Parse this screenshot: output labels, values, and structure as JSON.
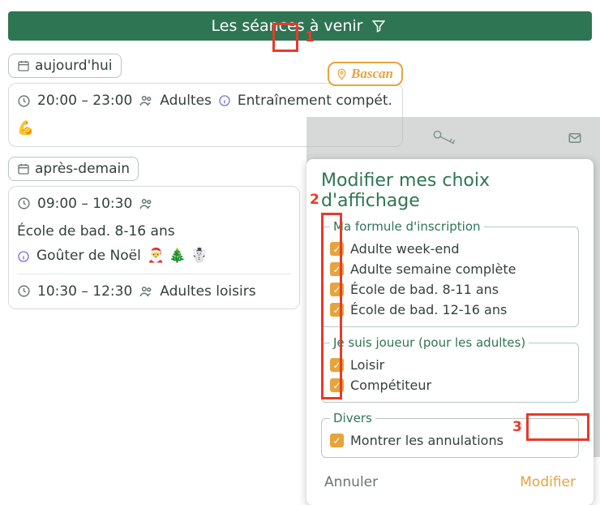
{
  "banner": {
    "title": "Les séances à venir"
  },
  "annotations": {
    "n1": "1",
    "n2": "2",
    "n3": "3"
  },
  "location": {
    "name": "Bascan"
  },
  "days": [
    {
      "label": "aujourd'hui",
      "sessions": [
        {
          "time": "20:00 – 23:00",
          "audience": "Adultes",
          "info": "Entraînement compét.",
          "emoji": "💪"
        }
      ]
    },
    {
      "label": "après-demain",
      "sessions": [
        {
          "time": "09:00 – 10:30",
          "audience": "École de bad. 8-16 ans",
          "info": "Goûter de Noël",
          "emoji": "🎅 🎄 ☃️"
        },
        {
          "time": "10:30 – 12:30",
          "audience": "Adultes loisirs",
          "info": "",
          "emoji": ""
        }
      ]
    }
  ],
  "modal": {
    "title": "Modifier mes choix d'affichage",
    "groups": [
      {
        "legend": "Ma formule d'inscription",
        "options": [
          "Adulte week-end",
          "Adulte semaine complète",
          "École de bad. 8-11 ans",
          "École de bad. 12-16 ans"
        ]
      },
      {
        "legend": "Je suis joueur (pour les adultes)",
        "options": [
          "Loisir",
          "Compétiteur"
        ]
      },
      {
        "legend": "Divers",
        "options": [
          "Montrer les annulations"
        ]
      }
    ],
    "cancel": "Annuler",
    "confirm": "Modifier"
  }
}
